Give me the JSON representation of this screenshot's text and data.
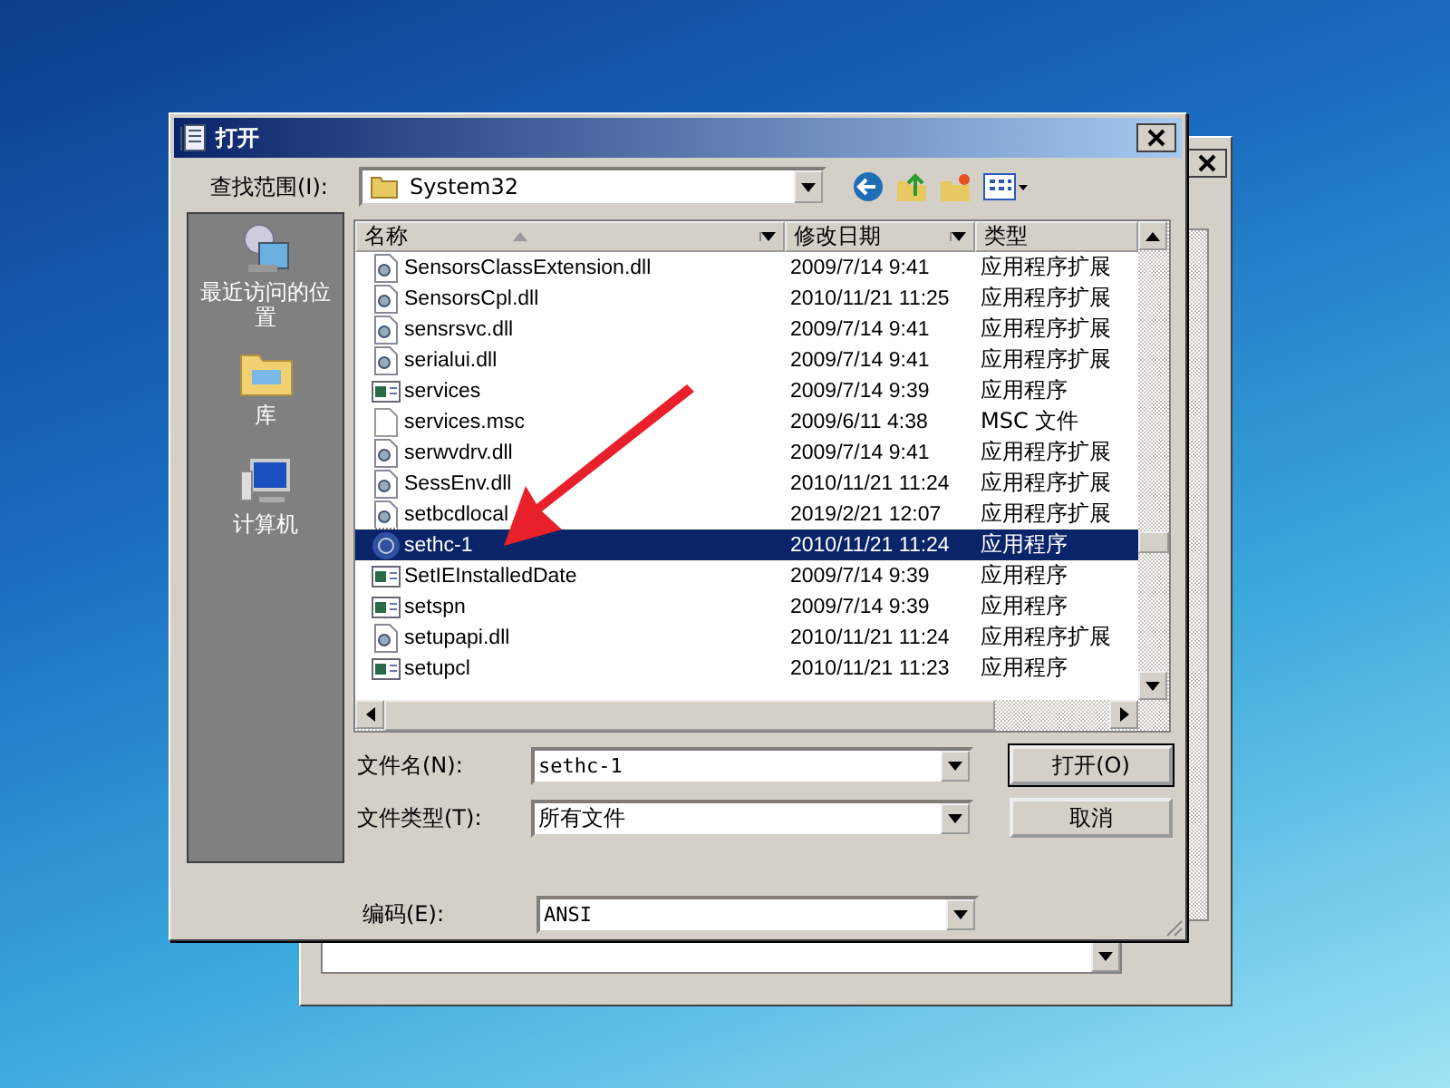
{
  "dialog": {
    "title": "打开",
    "look_in": {
      "label": "查找范围(I):",
      "value": "System32"
    },
    "places": [
      {
        "label": "最近访问的位置",
        "kind": "recent"
      },
      {
        "label": "库",
        "kind": "library"
      },
      {
        "label": "计算机",
        "kind": "computer"
      }
    ],
    "file_list": {
      "columns": [
        {
          "label": "名称",
          "sorted": true
        },
        {
          "label": "修改日期",
          "sorted": false
        },
        {
          "label": "类型",
          "sorted": false
        }
      ],
      "rows": [
        {
          "name": "SensorsClassExtension.dll",
          "date": "2009/7/14 9:41",
          "type": "应用程序扩展",
          "kind": "dll",
          "selected": false
        },
        {
          "name": "SensorsCpl.dll",
          "date": "2010/11/21 11:25",
          "type": "应用程序扩展",
          "kind": "dll",
          "selected": false
        },
        {
          "name": "sensrsvc.dll",
          "date": "2009/7/14 9:41",
          "type": "应用程序扩展",
          "kind": "dll",
          "selected": false
        },
        {
          "name": "serialui.dll",
          "date": "2009/7/14 9:41",
          "type": "应用程序扩展",
          "kind": "dll",
          "selected": false
        },
        {
          "name": "services",
          "date": "2009/7/14 9:39",
          "type": "应用程序",
          "kind": "exe",
          "selected": false
        },
        {
          "name": "services.msc",
          "date": "2009/6/11 4:38",
          "type": "MSC 文件",
          "kind": "file",
          "selected": false
        },
        {
          "name": "serwvdrv.dll",
          "date": "2009/7/14 9:41",
          "type": "应用程序扩展",
          "kind": "dll",
          "selected": false
        },
        {
          "name": "SessEnv.dll",
          "date": "2010/11/21 11:24",
          "type": "应用程序扩展",
          "kind": "dll",
          "selected": false
        },
        {
          "name": "setbcdlocal",
          "date": "2019/2/21 12:07",
          "type": "应用程序扩展",
          "kind": "dll",
          "selected": false
        },
        {
          "name": "sethc-1",
          "date": "2010/11/21 11:24",
          "type": "应用程序",
          "kind": "round",
          "selected": true
        },
        {
          "name": "SetIEInstalledDate",
          "date": "2009/7/14 9:39",
          "type": "应用程序",
          "kind": "exe",
          "selected": false
        },
        {
          "name": "setspn",
          "date": "2009/7/14 9:39",
          "type": "应用程序",
          "kind": "exe",
          "selected": false
        },
        {
          "name": "setupapi.dll",
          "date": "2010/11/21 11:24",
          "type": "应用程序扩展",
          "kind": "dll",
          "selected": false
        },
        {
          "name": "setupcl",
          "date": "2010/11/21 11:23",
          "type": "应用程序",
          "kind": "exe",
          "selected": false
        }
      ]
    },
    "file_name": {
      "label": "文件名(N):",
      "value": "sethc-1"
    },
    "file_type": {
      "label": "文件类型(T):",
      "value": "所有文件"
    },
    "encoding": {
      "label": "编码(E):",
      "value": "ANSI"
    },
    "buttons": [
      {
        "label": "打开(O)",
        "default": true
      },
      {
        "label": "取消",
        "default": false
      }
    ]
  }
}
